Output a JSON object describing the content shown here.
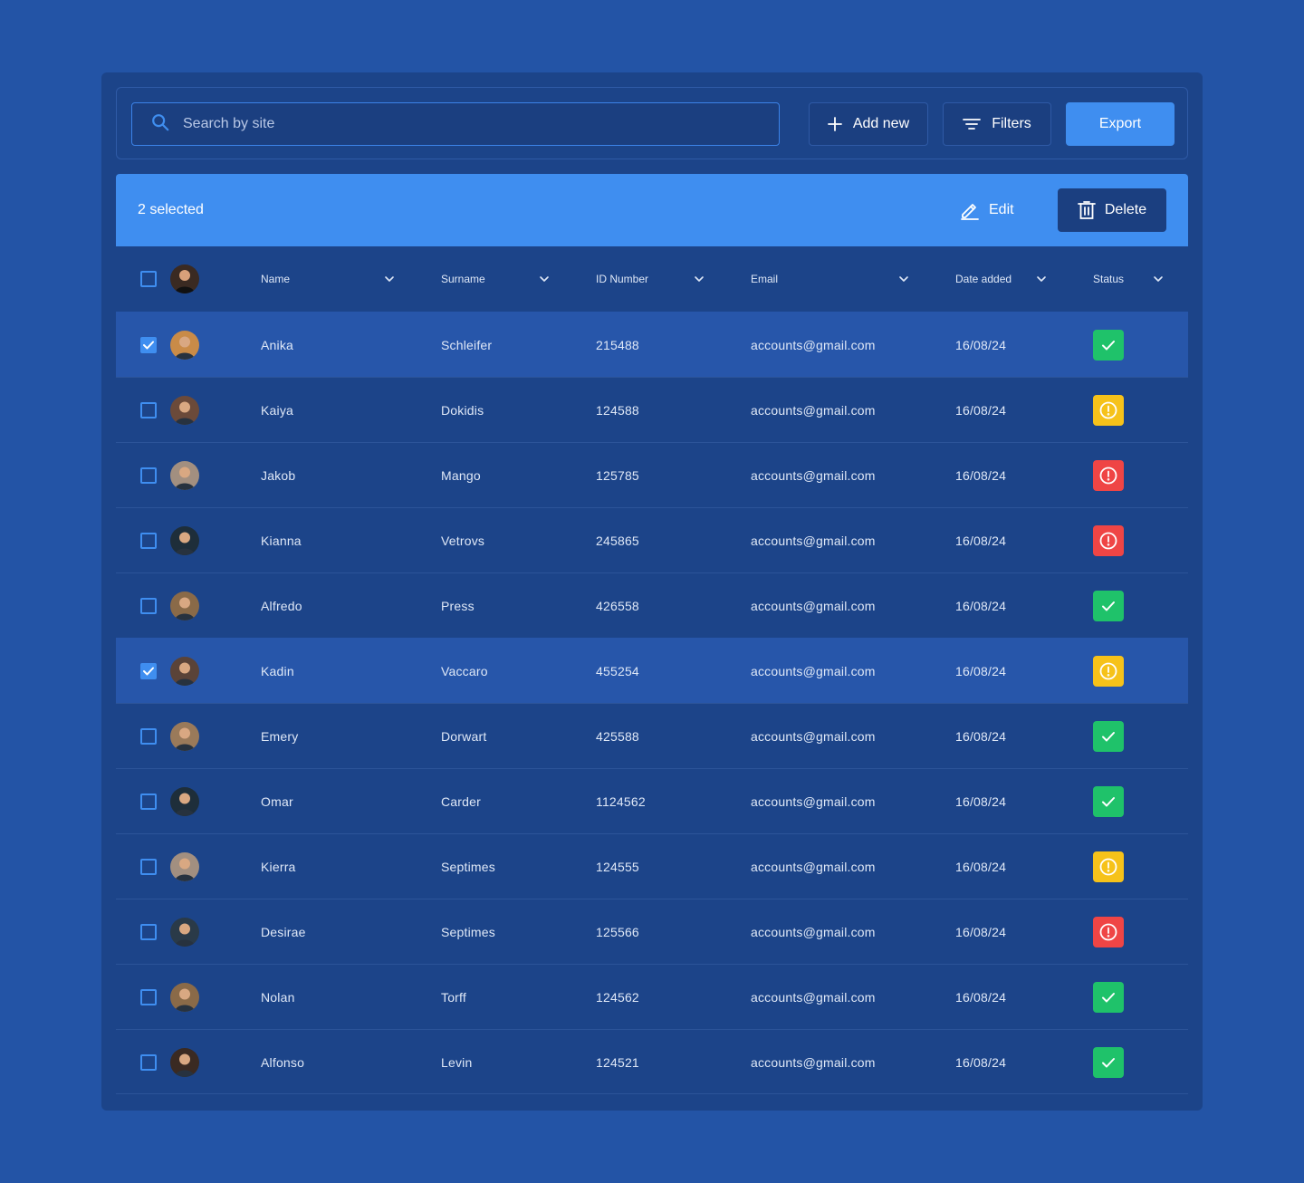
{
  "toolbar": {
    "search_placeholder": "Search by site",
    "add_new_label": "Add new",
    "filters_label": "Filters",
    "export_label": "Export"
  },
  "selection": {
    "count_label": "2 selected",
    "edit_label": "Edit",
    "delete_label": "Delete"
  },
  "columns": {
    "name": "Name",
    "surname": "Surname",
    "id_number": "ID Number",
    "email": "Email",
    "date_added": "Date added",
    "status": "Status"
  },
  "colors": {
    "status_ok": "#1fc26a",
    "status_warning": "#f6c21a",
    "status_error": "#ef4545",
    "accent": "#3f8ef0"
  },
  "rows": [
    {
      "checked": true,
      "name": "Anika",
      "surname": "Schleifer",
      "id": "215488",
      "email": "accounts@gmail.com",
      "date": "16/08/24",
      "status": "ok",
      "avatar": "#c98b48"
    },
    {
      "checked": false,
      "name": "Kaiya",
      "surname": "Dokidis",
      "id": "124588",
      "email": "accounts@gmail.com",
      "date": "16/08/24",
      "status": "warning",
      "avatar": "#6b4a3a"
    },
    {
      "checked": false,
      "name": "Jakob",
      "surname": "Mango",
      "id": "125785",
      "email": "accounts@gmail.com",
      "date": "16/08/24",
      "status": "error",
      "avatar": "#a28f80"
    },
    {
      "checked": false,
      "name": "Kianna",
      "surname": "Vetrovs",
      "id": "245865",
      "email": "accounts@gmail.com",
      "date": "16/08/24",
      "status": "error",
      "avatar": "#1e2e3a"
    },
    {
      "checked": false,
      "name": "Alfredo",
      "surname": "Press",
      "id": "426558",
      "email": "accounts@gmail.com",
      "date": "16/08/24",
      "status": "ok",
      "avatar": "#8a6a48"
    },
    {
      "checked": true,
      "name": "Kadin",
      "surname": "Vaccaro",
      "id": "455254",
      "email": "accounts@gmail.com",
      "date": "16/08/24",
      "status": "warning",
      "avatar": "#5a4338"
    },
    {
      "checked": false,
      "name": "Emery",
      "surname": "Dorwart",
      "id": "425588",
      "email": "accounts@gmail.com",
      "date": "16/08/24",
      "status": "ok",
      "avatar": "#9a7a5a"
    },
    {
      "checked": false,
      "name": "Omar",
      "surname": "Carder",
      "id": "1124562",
      "email": "accounts@gmail.com",
      "date": "16/08/24",
      "status": "ok",
      "avatar": "#1e2e3a"
    },
    {
      "checked": false,
      "name": "Kierra",
      "surname": "Septimes",
      "id": "124555",
      "email": "accounts@gmail.com",
      "date": "16/08/24",
      "status": "warning",
      "avatar": "#a28f80"
    },
    {
      "checked": false,
      "name": "Desirae",
      "surname": "Septimes",
      "id": "125566",
      "email": "accounts@gmail.com",
      "date": "16/08/24",
      "status": "error",
      "avatar": "#2a3a48"
    },
    {
      "checked": false,
      "name": "Nolan",
      "surname": "Torff",
      "id": "124562",
      "email": "accounts@gmail.com",
      "date": "16/08/24",
      "status": "ok",
      "avatar": "#8a6a48"
    },
    {
      "checked": false,
      "name": "Alfonso",
      "surname": "Levin",
      "id": "124521",
      "email": "accounts@gmail.com",
      "date": "16/08/24",
      "status": "ok",
      "avatar": "#3a2a22"
    }
  ]
}
